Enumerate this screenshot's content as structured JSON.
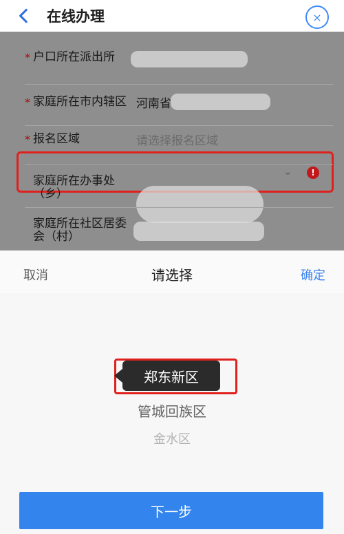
{
  "header": {
    "back_icon": "chevron-left-icon",
    "title": "在线办理",
    "close_icon": "close-circle-icon"
  },
  "form": {
    "rows": [
      {
        "label": "户口所在派出所",
        "value": ""
      },
      {
        "label": "家庭所在市内辖区",
        "value": "河南省"
      },
      {
        "label": "报名区域",
        "placeholder": "请选择报名区域"
      },
      {
        "label": "家庭所在办事处（乡）",
        "value": ""
      },
      {
        "label": "家庭所在社区居委会（村）",
        "value": ""
      }
    ]
  },
  "picker": {
    "cancel_label": "取消",
    "title": "请选择",
    "confirm_label": "确定",
    "options": [
      "郑东新区",
      "管城回族区",
      "金水区"
    ],
    "selected_label": "郑东新区"
  },
  "actions": {
    "next_label": "下一步"
  },
  "colors": {
    "accent": "#3384ec",
    "highlight": "#e0201d",
    "alert": "#c3181b"
  }
}
